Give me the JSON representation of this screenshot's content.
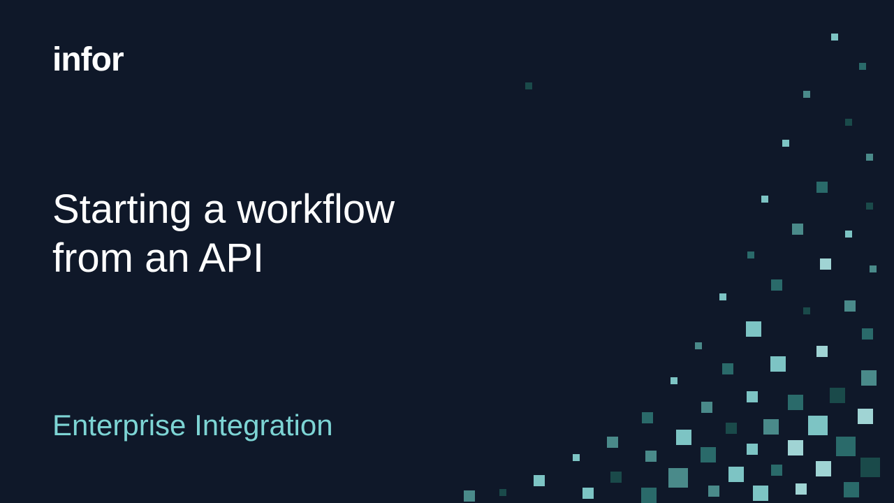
{
  "logo": "infor",
  "title_line1": "Starting a workflow",
  "title_line2": "from an API",
  "subtitle": "Enterprise Integration"
}
